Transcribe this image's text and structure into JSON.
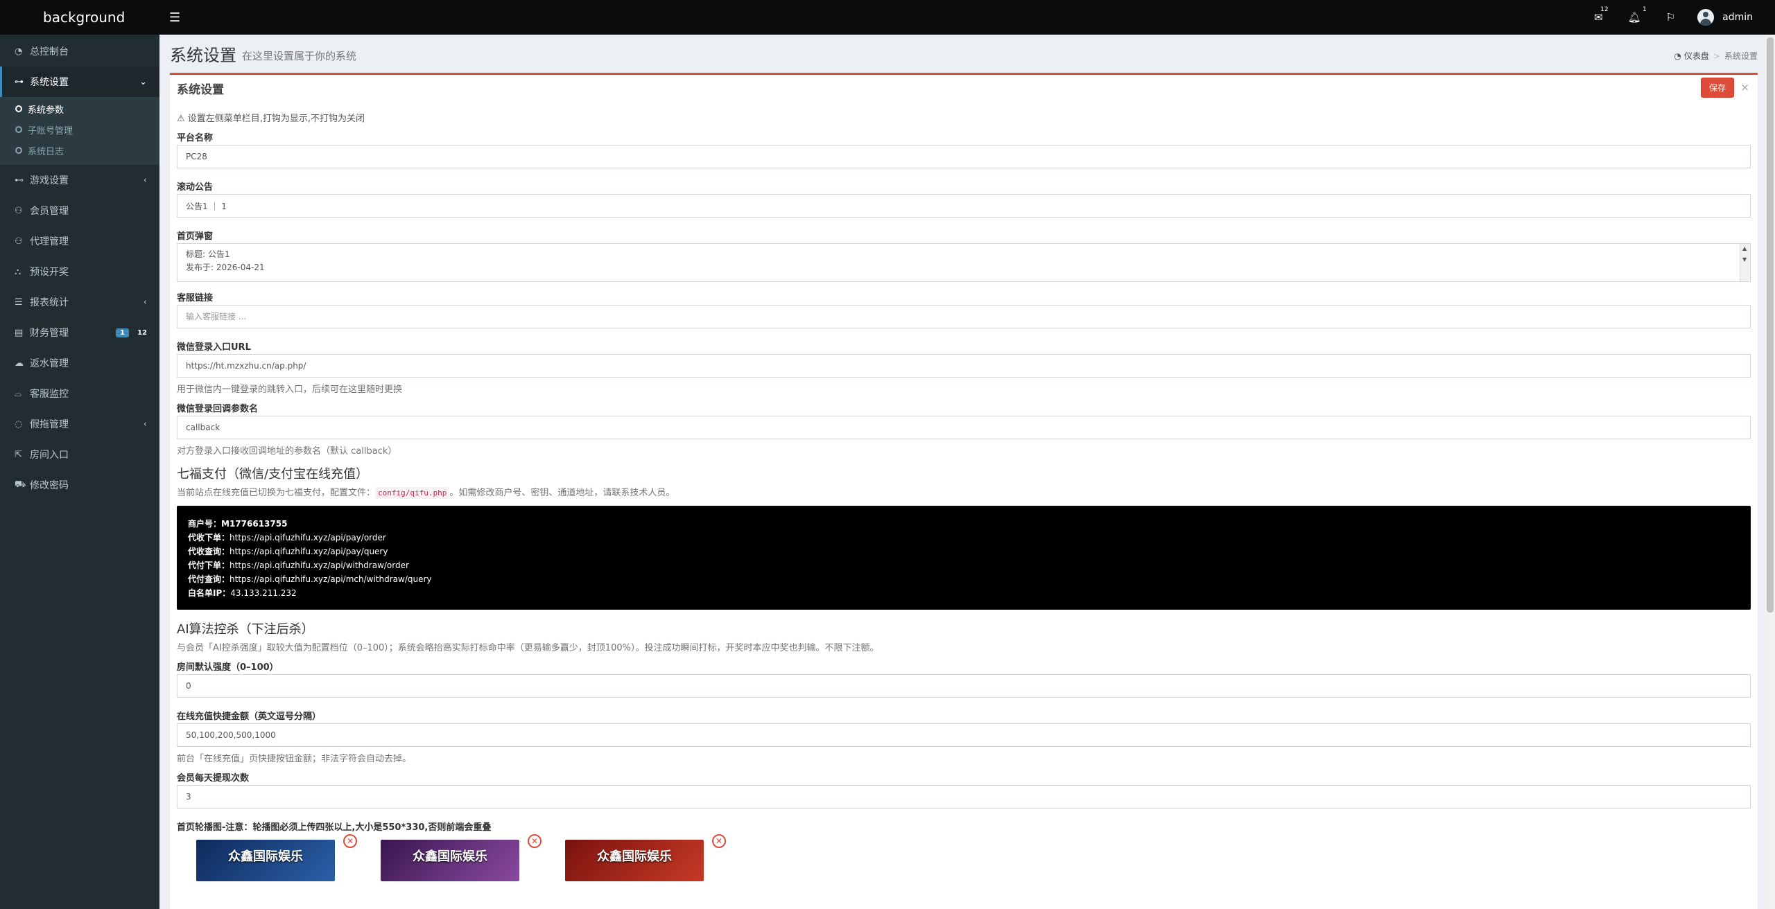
{
  "logo": "background",
  "menu": [
    {
      "icon": "dashboard-icon",
      "glyph": "◔",
      "label": "总控制台"
    },
    {
      "icon": "toggle-icon",
      "glyph": "⊶",
      "label": "系统设置",
      "active": true
    },
    {
      "icon": "gamepad-icon",
      "glyph": "⊷",
      "label": "游戏设置"
    },
    {
      "icon": "users-icon",
      "glyph": "👥",
      "label": "会员管理"
    },
    {
      "icon": "agents-icon",
      "glyph": "👥",
      "label": "代理管理"
    },
    {
      "icon": "share-icon",
      "glyph": "⛬",
      "label": "预设开奖"
    },
    {
      "icon": "list-icon",
      "glyph": "☰",
      "label": "报表统计"
    },
    {
      "icon": "database-icon",
      "glyph": "▤",
      "label": "财务管理",
      "badge1": "1",
      "badge2": "12"
    },
    {
      "icon": "cloud-icon",
      "glyph": "☁",
      "label": "返水管理"
    },
    {
      "icon": "headset-icon",
      "glyph": "⌓",
      "label": "客服监控"
    },
    {
      "icon": "comments-icon",
      "glyph": "💬",
      "label": "假拖管理"
    },
    {
      "icon": "external-link-icon",
      "glyph": "⇱",
      "label": "房间入口"
    },
    {
      "icon": "cart-icon",
      "glyph": "🛒",
      "label": "修改密码"
    }
  ],
  "submenu": [
    {
      "label": "系统参数",
      "active": true
    },
    {
      "label": "子账号管理"
    },
    {
      "label": "系统日志"
    }
  ],
  "topbar": {
    "mail_badge": "12",
    "bell_badge": "1",
    "username": "admin"
  },
  "header": {
    "title": "系统设置",
    "subtitle": "在这里设置属于你的系统",
    "breadcrumb_home": "仪表盘",
    "breadcrumb_current": "系统设置"
  },
  "box": {
    "title": "系统设置",
    "save_label": "保存",
    "close_glyph": "×"
  },
  "form": {
    "hint": "设置左侧菜单栏目,打钩为显示,不打钩为关闭",
    "platform_label": "平台名称",
    "platform_value": "PC28",
    "notice_label": "滚动公告",
    "notice_value": "公告1 ｜ 1",
    "popup_label": "首页弹窗",
    "popup_line1": "标题: 公告1",
    "popup_line2": "发布于: 2026-04-21",
    "service_label": "客服链接",
    "service_placeholder": "输入客服链接 ...",
    "wx_url_label": "微信登录入口URL",
    "wx_url_value": "https://ht.mzxzhu.cn/ap.php/",
    "wx_url_help": "用于微信内一键登录的跳转入口，后续可在这里随时更换",
    "wx_cb_label": "微信登录回调参数名",
    "wx_cb_value": "callback",
    "wx_cb_help": "对方登录入口接收回调地址的参数名（默认 callback）",
    "pay_title": "七福支付（微信/支付宝在线充值）",
    "pay_desc_before": "当前站点在线充值已切换为七福支付，配置文件：",
    "pay_desc_code": "config/qifu.php",
    "pay_desc_after": "。如需修改商户号、密钥、通道地址，请联系技术人员。",
    "ai_title": "AI算法控杀（下注后杀）",
    "ai_desc": "与会员「AI控杀强度」取较大值为配置档位（0–100）；系统会略抬高实际打标命中率（更易输多赢少，封顶100%）。投注成功瞬间打标，开奖时本应中奖也判输。不限下注额。",
    "room_strength_label": "房间默认强度（0–100）",
    "room_strength_value": "0",
    "quick_amount_label": "在线充值快捷金额（英文逗号分隔）",
    "quick_amount_value": "50,100,200,500,1000",
    "quick_amount_help": "前台「在线充值」页快捷按钮金额；非法字符会自动去掉。",
    "withdraw_label": "会员每天提现次数",
    "withdraw_value": "3",
    "carousel_label": "首页轮播图-注意：轮播图必须上传四张以上,大小是550*330,否则前端会重叠"
  },
  "pay_block": [
    {
      "k": "商户号：",
      "v": "M1776613755"
    },
    {
      "k": "代收下单：",
      "v": "https://api.qifuzhifu.xyz/api/pay/order"
    },
    {
      "k": "代收查询：",
      "v": "https://api.qifuzhifu.xyz/api/pay/query"
    },
    {
      "k": "代付下单：",
      "v": "https://api.qifuzhifu.xyz/api/withdraw/order"
    },
    {
      "k": "代付查询：",
      "v": "https://api.qifuzhifu.xyz/api/mch/withdraw/query"
    },
    {
      "k": "白名单IP：",
      "v": "43.133.211.232"
    }
  ],
  "carousel": [
    {
      "caption": "众鑫国际娱乐",
      "bg": "#1c3e7a"
    },
    {
      "caption": "众鑫国际娱乐",
      "bg": "#5a2a6e"
    },
    {
      "caption": "众鑫国际娱乐",
      "bg": "#a8241c"
    }
  ],
  "colors": {
    "accent_red": "#dd4b39",
    "sidebar_bg": "#222d32",
    "topbar_bg": "#0b0c0e",
    "link_blue": "#3c8dbc"
  }
}
